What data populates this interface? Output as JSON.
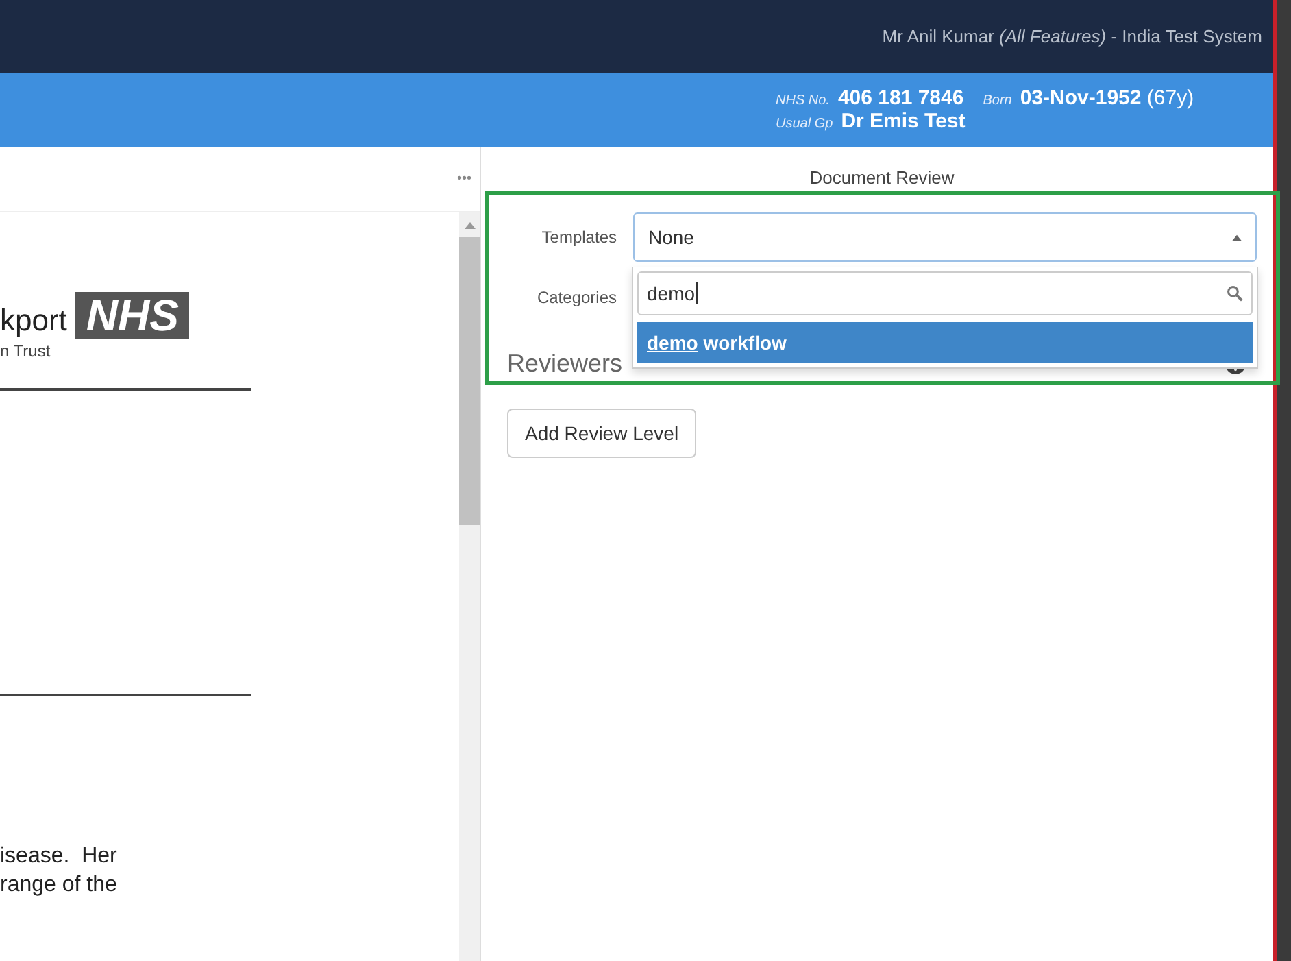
{
  "top_bar": {
    "user": "Mr Anil Kumar",
    "role": "(All Features)",
    "system": "- India Test System"
  },
  "patient_banner": {
    "nhs_label": "NHS No.",
    "nhs_number": "406 181 7846",
    "born_label": "Born",
    "born": "03-Nov-1952",
    "age": "(67y)",
    "gp_label": "Usual Gp",
    "gp": "Dr Emis Test"
  },
  "document_viewer": {
    "menu": "•••",
    "org_name": "kport",
    "logo": "NHS",
    "org_subtitle": "n Trust",
    "body_lines": [
      "isease.  Her",
      "range of the"
    ]
  },
  "review_panel": {
    "title": "Document Review",
    "fields": [
      {
        "label": "Templates",
        "value": "None",
        "expanded": true
      },
      {
        "label": "Categories"
      }
    ],
    "dropdown": {
      "search_value": "demo",
      "options": [
        {
          "match": "demo",
          "rest": " workflow",
          "selected": true
        }
      ]
    },
    "reviewers_heading": "Reviewers",
    "add_button": "Add Review Level"
  }
}
